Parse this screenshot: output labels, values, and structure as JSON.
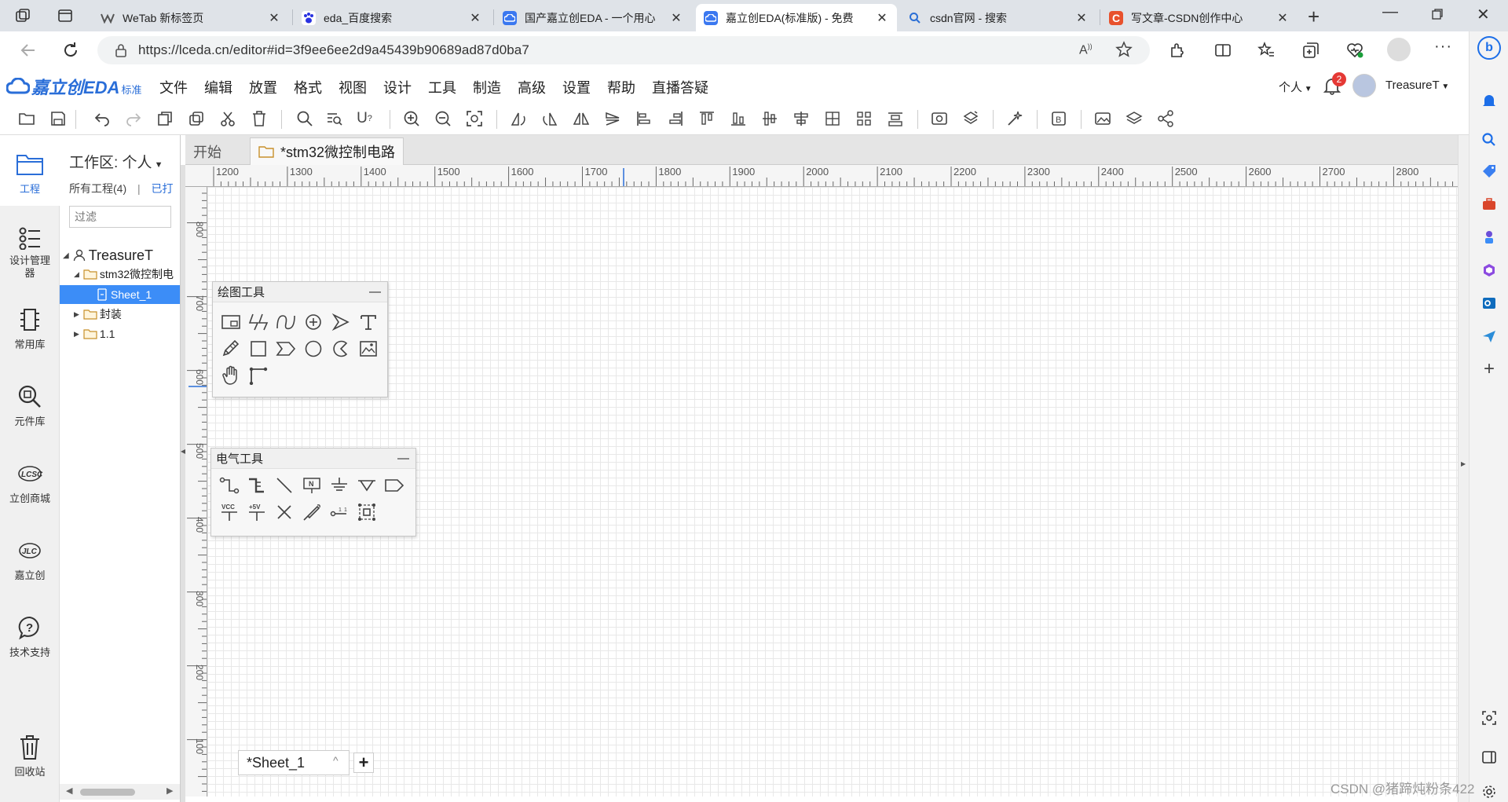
{
  "browser": {
    "tabs": [
      {
        "title": "WeTab 新标签页",
        "icon": "wetab-icon",
        "active": false
      },
      {
        "title": "eda_百度搜索",
        "icon": "baidu-paw-icon",
        "active": false
      },
      {
        "title": "国产嘉立创EDA - 一个用心",
        "icon": "lceda-cloud-icon",
        "active": false
      },
      {
        "title": "嘉立创EDA(标准版) - 免费",
        "icon": "lceda-cloud-icon",
        "active": true
      },
      {
        "title": "csdn官网 - 搜索",
        "icon": "bing-search-icon",
        "active": false
      },
      {
        "title": "写文章-CSDN创作中心",
        "icon": "csdn-c-icon",
        "active": false
      }
    ],
    "url": "https://lceda.cn/editor#id=3f9ee6ee2d9a45439b90689ad87d0ba7"
  },
  "app": {
    "logo_text": "嘉立创EDA",
    "edition": "标准",
    "menus": [
      "文件",
      "编辑",
      "放置",
      "格式",
      "视图",
      "设计",
      "工具",
      "制造",
      "高级",
      "设置",
      "帮助",
      "直播答疑"
    ],
    "scope_label": "个人",
    "notification_count": "2",
    "username": "TreasureT"
  },
  "leftnav": [
    {
      "label": "工程",
      "icon": "folder-project-icon"
    },
    {
      "label": "设计管理器",
      "icon": "design-manager-icon"
    },
    {
      "label": "常用库",
      "icon": "chip-library-icon"
    },
    {
      "label": "元件库",
      "icon": "component-search-icon"
    },
    {
      "label": "立创商城",
      "icon": "lcsc-logo-icon"
    },
    {
      "label": "嘉立创",
      "icon": "jlc-logo-icon"
    },
    {
      "label": "技术支持",
      "icon": "help-bubble-icon"
    },
    {
      "label": "回收站",
      "icon": "trash-icon"
    }
  ],
  "project_panel": {
    "workspace_label": "工作区: 个人",
    "all_projects": "所有工程(4)",
    "opened": "已打",
    "filter_placeholder": "过滤",
    "tree": {
      "user": "TreasureT",
      "project": "stm32微控制电",
      "sheet": "Sheet_1",
      "folder1": "封装",
      "folder2": "1.1"
    }
  },
  "workspace": {
    "tabs": [
      "开始",
      "*stm32微控制电路"
    ],
    "ruler_x": [
      "1200",
      "1300",
      "1400",
      "1500",
      "1600",
      "1700",
      "1800",
      "1900",
      "2000",
      "2100",
      "2200",
      "2300",
      "2400",
      "2500",
      "2600",
      "2700",
      "2800"
    ],
    "ruler_y": [
      "800",
      "700",
      "600",
      "500",
      "400",
      "300",
      "200",
      "100"
    ],
    "sheet_tab": "*Sheet_1",
    "add_sheet": "+"
  },
  "palettes": {
    "drawing": {
      "title": "绘图工具",
      "collapse": "—"
    },
    "electrical": {
      "title": "电气工具",
      "collapse": "—"
    }
  },
  "watermark": "CSDN @猪蹄炖粉条422",
  "colors": {
    "accent": "#2a6ed8",
    "selected": "#3c8df7",
    "badge": "#e53935"
  }
}
